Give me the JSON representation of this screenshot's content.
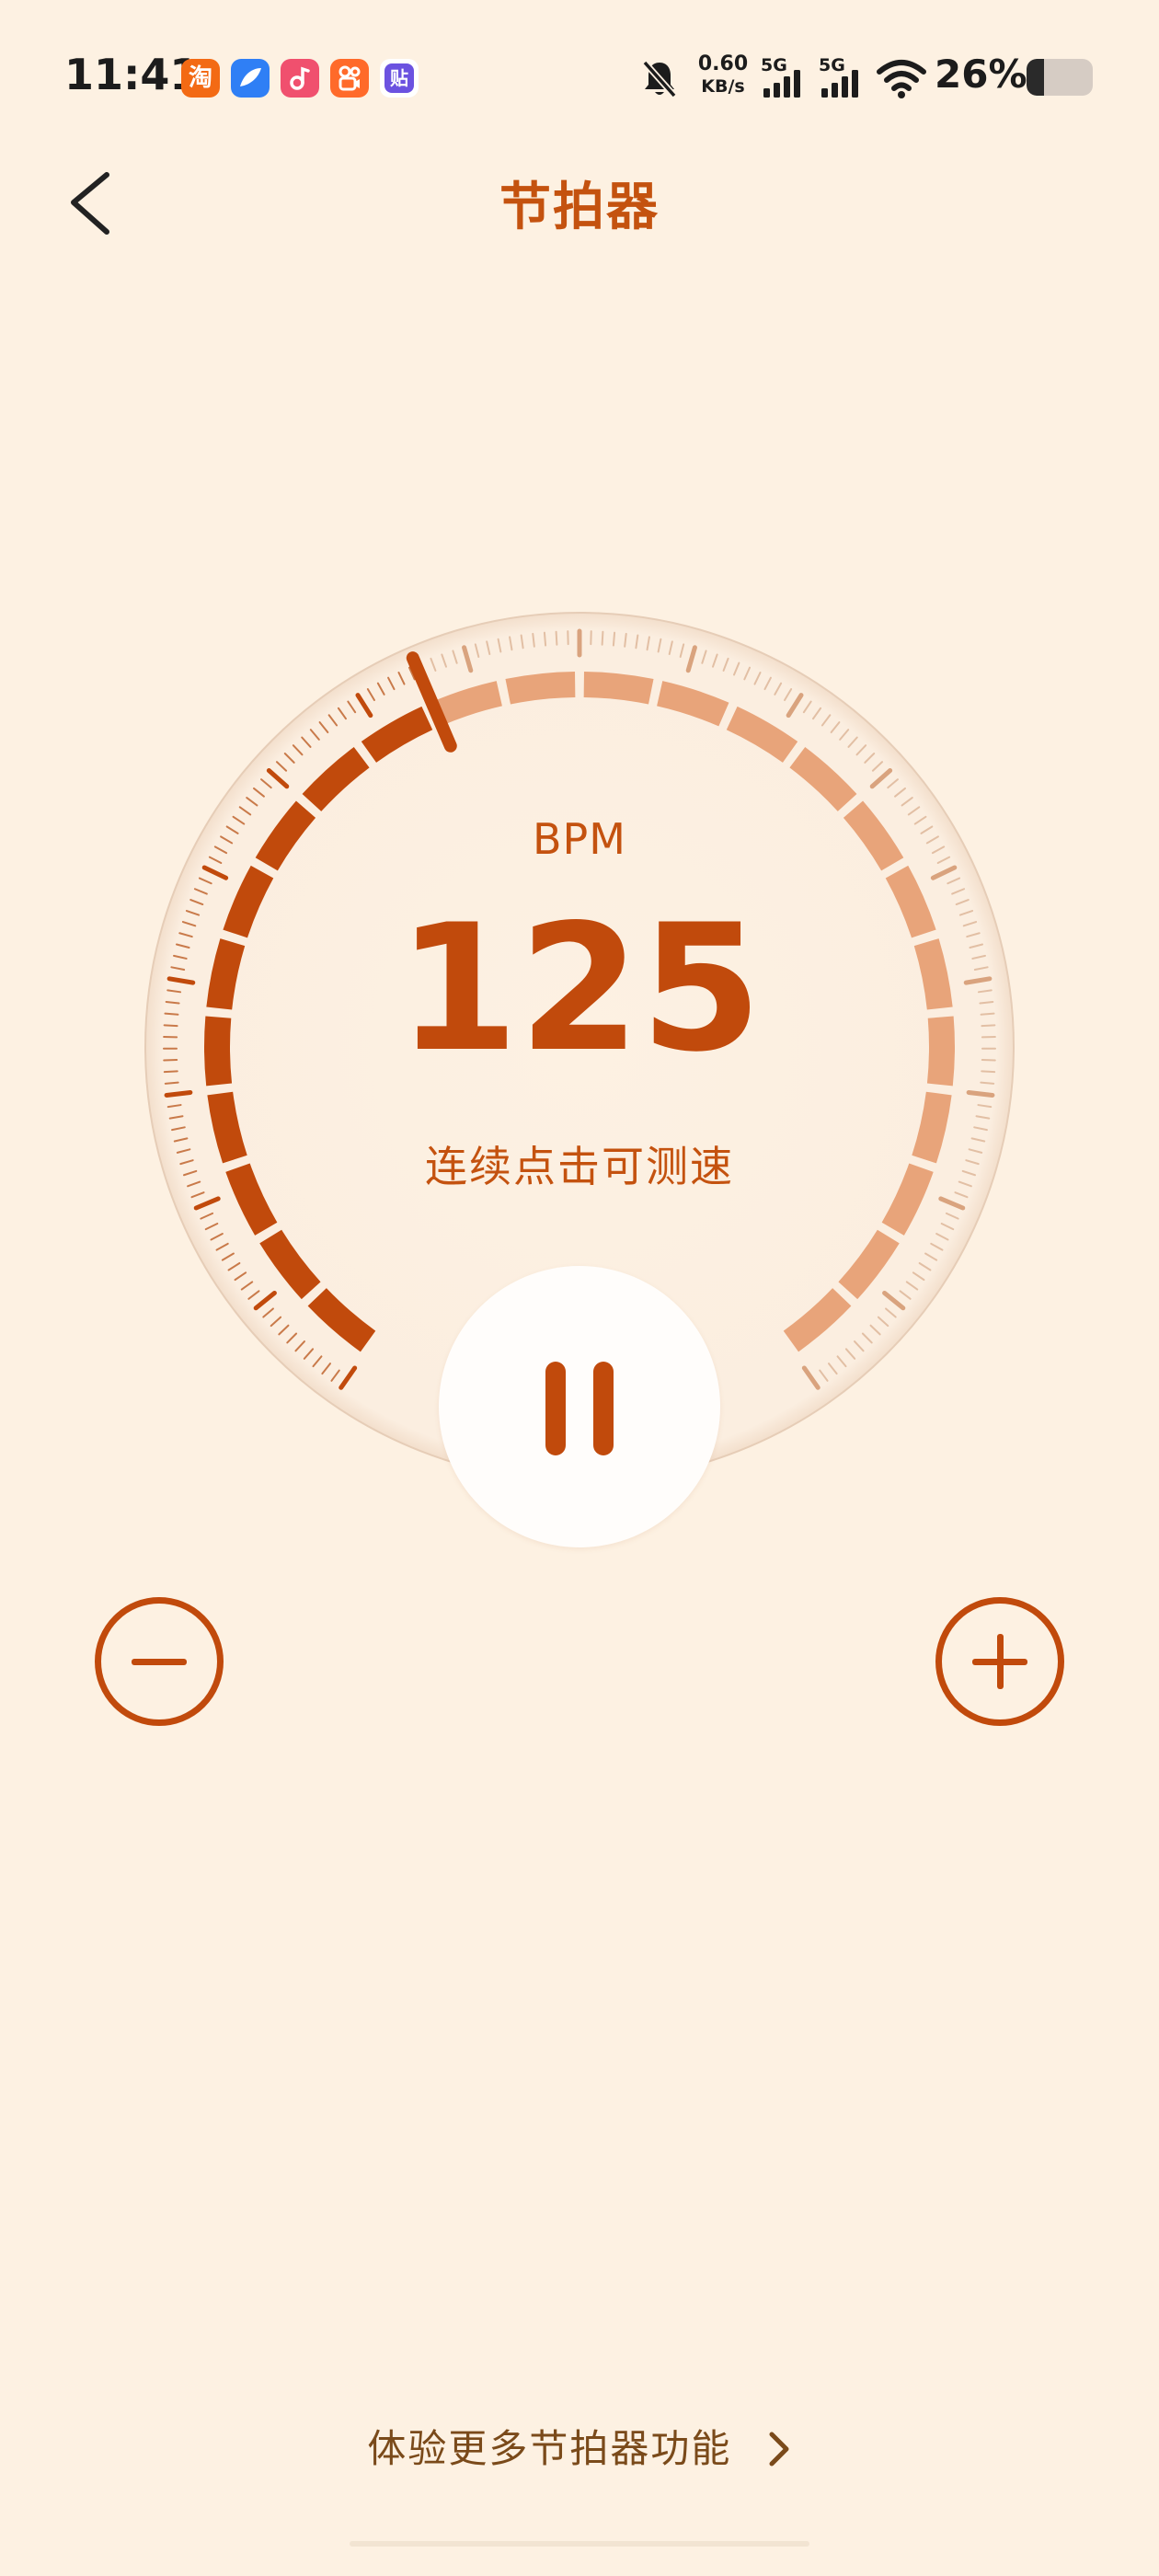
{
  "status_bar": {
    "time": "11:41",
    "app_icons": [
      {
        "name": "taobao-icon",
        "glyph": "淘",
        "color": "#f36a14"
      },
      {
        "name": "feather-app-icon",
        "glyph": "",
        "color": "#2f7ff5"
      },
      {
        "name": "music-app-icon",
        "glyph": "♪",
        "color": "#f0506e"
      },
      {
        "name": "kuaishou-icon",
        "glyph": "",
        "color": "#ff6a2a"
      },
      {
        "name": "tieba-icon",
        "glyph": "贴",
        "color": "#6b52e0"
      }
    ],
    "net_speed_value": "0.60",
    "net_speed_unit": "KB/s",
    "sim1_label": "5G",
    "sim2_label": "5G",
    "battery_percent_text": "26%",
    "battery_level": 0.26,
    "icons": [
      "mute-icon",
      "signal-icon",
      "wifi-icon",
      "battery-icon"
    ]
  },
  "header": {
    "title": "节拍器",
    "back_icon": "chevron-left-icon"
  },
  "metronome": {
    "bpm_label": "BPM",
    "bpm_value": "125",
    "tap_hint": "连续点击可测速",
    "tempo_fraction": 0.42,
    "state": "playing",
    "pause_icon": "pause-icon",
    "decrease_icon": "minus-circle-icon",
    "increase_icon": "plus-circle-icon"
  },
  "footer": {
    "more_link": "体验更多节拍器功能",
    "more_icon": "chevron-right-icon"
  },
  "colors": {
    "background": "#fdf1e2",
    "accent": "#c14a0c",
    "accent_light": "#e8a47a",
    "text_brown": "#7a4a1a"
  }
}
